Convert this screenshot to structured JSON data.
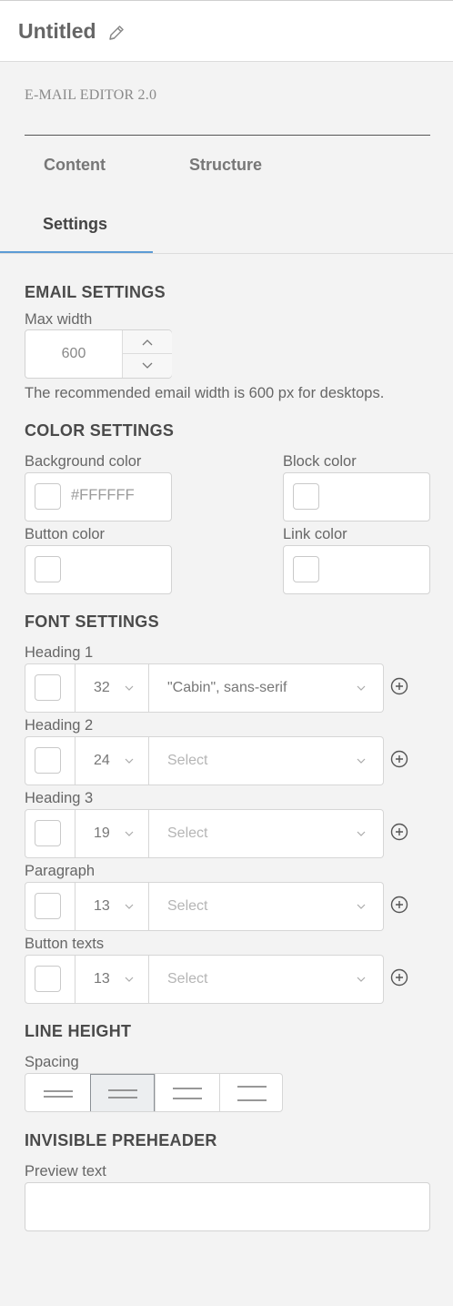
{
  "header": {
    "title": "Untitled",
    "edit_icon": "pencil-icon"
  },
  "brand": {
    "label": "E-MAIL EDITOR 2.0"
  },
  "tabs": [
    {
      "label": "Content",
      "active": false
    },
    {
      "label": "Structure",
      "active": false
    },
    {
      "label": "Settings",
      "active": true
    }
  ],
  "accent_color": "#5b9bd5",
  "email_settings": {
    "heading": "EMAIL SETTINGS",
    "max_width_label": "Max width",
    "max_width_value": "600",
    "note": "The recommended email width is 600 px for desktops."
  },
  "color_settings": {
    "heading": "COLOR SETTINGS",
    "background": {
      "label": "Background color",
      "value": "#FFFFFF"
    },
    "block": {
      "label": "Block color",
      "value": ""
    },
    "button": {
      "label": "Button color",
      "value": ""
    },
    "link": {
      "label": "Link color",
      "value": ""
    }
  },
  "font_settings": {
    "heading": "FONT SETTINGS",
    "rows": [
      {
        "label": "Heading 1",
        "size": "32",
        "family": "\"Cabin\", sans-serif",
        "placeholder": false
      },
      {
        "label": "Heading 2",
        "size": "24",
        "family": "Select",
        "placeholder": true
      },
      {
        "label": "Heading 3",
        "size": "19",
        "family": "Select",
        "placeholder": true
      },
      {
        "label": "Paragraph",
        "size": "13",
        "family": "Select",
        "placeholder": true
      },
      {
        "label": "Button texts",
        "size": "13",
        "family": "Select",
        "placeholder": true
      }
    ]
  },
  "line_height": {
    "heading": "LINE HEIGHT",
    "spacing_label": "Spacing",
    "options": [
      "line-spacing-1-icon",
      "line-spacing-2-icon",
      "line-spacing-3-icon",
      "line-spacing-4-icon"
    ],
    "selected_index": 1
  },
  "preheader": {
    "heading": "INVISIBLE PREHEADER",
    "preview_label": "Preview text",
    "preview_value": ""
  }
}
